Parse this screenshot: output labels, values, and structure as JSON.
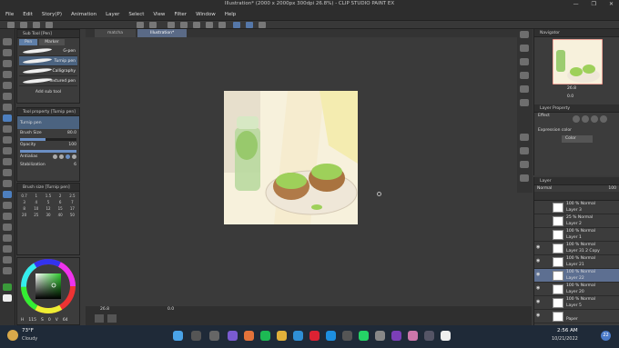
{
  "window": {
    "title": "Illustration* (2000 x 2000px 300dpi 26.8%) - CLIP STUDIO PAINT EX",
    "min_label": "—",
    "max_label": "❐",
    "close_label": "✕"
  },
  "menu": [
    "File",
    "Edit",
    "Story(P)",
    "Animation",
    "Layer",
    "Select",
    "View",
    "Filter",
    "Window",
    "Help"
  ],
  "canvas_tabs": [
    "matcha",
    "Illustration*"
  ],
  "sub_tool": {
    "header": "Sub Tool [Pen]",
    "tabs": [
      "Pen",
      "Marker"
    ],
    "brushes": [
      "G-pen",
      "Turnip pen",
      "Calligraphy",
      "Textured pen"
    ],
    "selected_brush_index": 1,
    "add_label": "Add sub tool"
  },
  "tool_property": {
    "header": "Tool property [Turnip pen]",
    "name": "Turnip pen",
    "brush_size_label": "Brush Size",
    "brush_size_value": "80.0",
    "opacity_label": "Opacity",
    "opacity_value": "100",
    "antialias_label": "Antialias",
    "stabilization_label": "Stabilization",
    "stabilization_value": "6"
  },
  "brush_size_panel": {
    "header": "Brush size [Turnip pen]",
    "sizes": [
      "0.7",
      "1",
      "1.5",
      "2",
      "2.5",
      "3",
      "4",
      "5",
      "6",
      "7",
      "8",
      "10",
      "12",
      "15",
      "17",
      "20",
      "25",
      "30",
      "40",
      "50"
    ]
  },
  "color": {
    "main": "#3a9a3a",
    "h": "115",
    "s": "0",
    "v": "64",
    "h_label": "H",
    "s_label": "S",
    "v_label": "V"
  },
  "navigator": {
    "header": "Navigator",
    "zoom": "26.8",
    "angle": "0.0"
  },
  "layer_property": {
    "header": "Layer Property",
    "effect_label": "Effect",
    "expression_label": "Expression color",
    "expression_value": "Color"
  },
  "layer": {
    "header": "Layer",
    "blend": "Normal",
    "opacity": "100",
    "rows": [
      {
        "line1": "100 % Normal",
        "line2": "Layer 3",
        "visible": false,
        "selected": false
      },
      {
        "line1": "25 % Normal",
        "line2": "Layer 2",
        "visible": false,
        "selected": false
      },
      {
        "line1": "100 % Normal",
        "line2": "Layer 1",
        "visible": false,
        "selected": false
      },
      {
        "line1": "100 % Normal",
        "line2": "Layer 31 2 Copy",
        "visible": true,
        "selected": false
      },
      {
        "line1": "100 % Normal",
        "line2": "Layer 21",
        "visible": true,
        "selected": false
      },
      {
        "line1": "100 % Normal",
        "line2": "Layer 22",
        "visible": true,
        "selected": true
      },
      {
        "line1": "100 % Normal",
        "line2": "Layer 20",
        "visible": true,
        "selected": false
      },
      {
        "line1": "100 % Normal",
        "line2": "Layer 5",
        "visible": true,
        "selected": false
      },
      {
        "line1": "",
        "line2": "Paper",
        "visible": true,
        "selected": false
      }
    ]
  },
  "status": {
    "zoom": "26.8",
    "angle": "0.0"
  },
  "taskbar": {
    "weather_temp": "73°F",
    "weather_desc": "Cloudy",
    "time": "2:56 AM",
    "date": "10/21/2022",
    "notifications": "22"
  }
}
